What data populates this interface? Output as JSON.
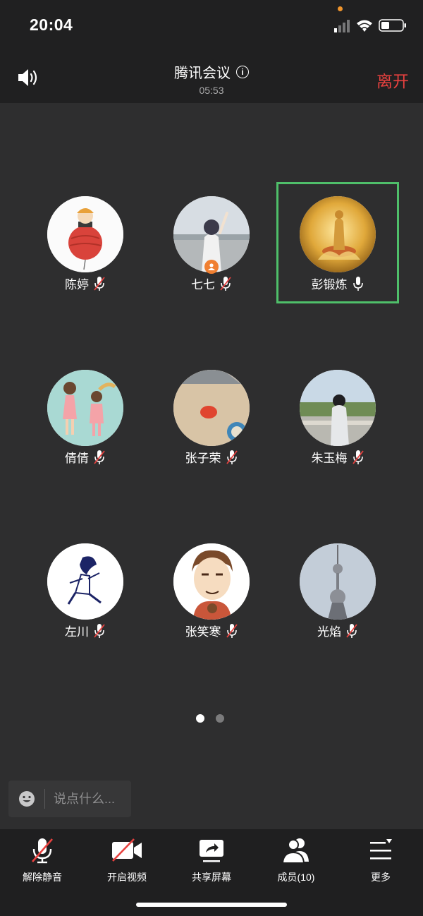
{
  "status_bar": {
    "time": "20:04"
  },
  "header": {
    "title": "腾讯会议",
    "timer": "05:53",
    "leave_label": "离开"
  },
  "members": [
    {
      "name": "陈婷",
      "mic": "muted",
      "active": false
    },
    {
      "name": "七七",
      "mic": "muted",
      "active": false,
      "host": true
    },
    {
      "name": "彭锻炼",
      "mic": "on",
      "active": true
    },
    {
      "name": "倩倩",
      "mic": "muted",
      "active": false
    },
    {
      "name": "张子荣",
      "mic": "muted",
      "active": false
    },
    {
      "name": "朱玉梅",
      "mic": "muted",
      "active": false
    },
    {
      "name": "左川",
      "mic": "muted",
      "active": false
    },
    {
      "name": "张笑寒",
      "mic": "muted",
      "active": false
    },
    {
      "name": "光焰",
      "mic": "muted",
      "active": false
    }
  ],
  "pager": {
    "pages": 2,
    "current": 1
  },
  "chat": {
    "placeholder": "说点什么..."
  },
  "toolbar": {
    "unmute_label": "解除静音",
    "video_label": "开启视频",
    "share_label": "共享屏幕",
    "members_label": "成员(10)",
    "more_label": "更多"
  },
  "colors": {
    "leave": "#e8413f",
    "active_border": "#4fbf6a",
    "host_badge": "#f07f31",
    "muted_slash": "#e8413f"
  }
}
